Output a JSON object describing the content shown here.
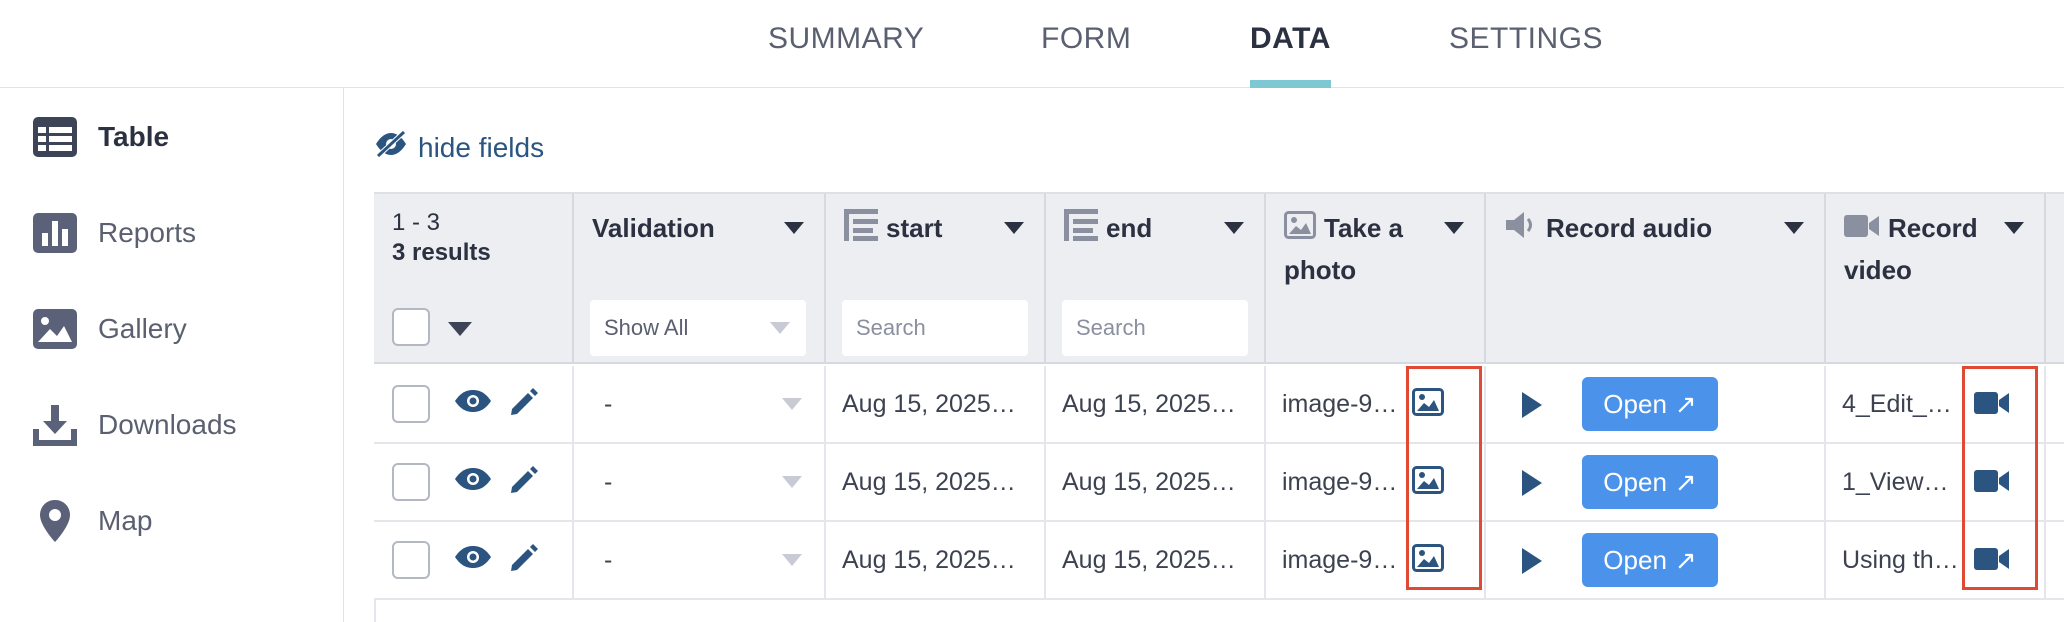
{
  "tabs": [
    {
      "label": "SUMMARY",
      "active": false
    },
    {
      "label": "FORM",
      "active": false
    },
    {
      "label": "DATA",
      "active": true
    },
    {
      "label": "SETTINGS",
      "active": false
    }
  ],
  "sidebar": {
    "items": [
      {
        "label": "Table",
        "icon": "table-icon",
        "active": true
      },
      {
        "label": "Reports",
        "icon": "reports-icon",
        "active": false
      },
      {
        "label": "Gallery",
        "icon": "gallery-icon",
        "active": false
      },
      {
        "label": "Downloads",
        "icon": "download-icon",
        "active": false
      },
      {
        "label": "Map",
        "icon": "map-pin-icon",
        "active": false
      }
    ]
  },
  "hide_fields_label": "hide fields",
  "table": {
    "range": "1 - 3",
    "results": "3 results",
    "columns": [
      {
        "label": "Validation",
        "filter": "Show All"
      },
      {
        "label": "start",
        "filter_placeholder": "Search"
      },
      {
        "label": "end",
        "filter_placeholder": "Search"
      },
      {
        "label": "Take a photo"
      },
      {
        "label": "Record audio"
      },
      {
        "label": "Record video"
      }
    ],
    "rows": [
      {
        "validation": "-",
        "start": "Aug 15, 2025…",
        "end": "Aug 15, 2025…",
        "photo": "image-9…",
        "audio_button": "Open",
        "video": "4_Edit_…"
      },
      {
        "validation": "-",
        "start": "Aug 15, 2025…",
        "end": "Aug 15, 2025…",
        "photo": "image-9…",
        "audio_button": "Open",
        "video": "1_View_…"
      },
      {
        "validation": "-",
        "start": "Aug 15, 2025…",
        "end": "Aug 15, 2025…",
        "photo": "image-9…",
        "audio_button": "Open",
        "video": "Using th…"
      }
    ]
  },
  "colors": {
    "accent": "#7ec8d3",
    "primary_button": "#4b93ea",
    "icon_blue": "#2b5580",
    "highlight": "#e04a33"
  }
}
